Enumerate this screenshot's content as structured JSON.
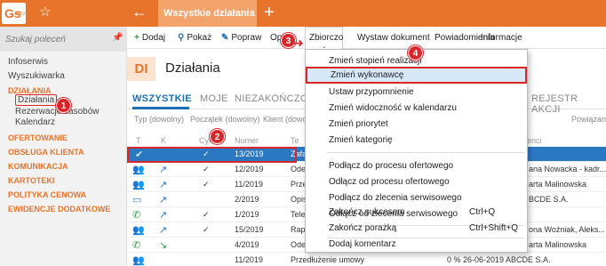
{
  "app": {
    "logo_text": "Gs",
    "logo_sub": "PRO",
    "active_tab": "Wszystkie działania",
    "star_icon": "star-outline-icon",
    "back_icon": "arrow-left-icon",
    "plus_icon": "plus-icon",
    "accent_color": "#e8732a",
    "selection_color": "#2b78c2",
    "highlight_color": "#d9262b"
  },
  "sidebar": {
    "search_placeholder": "Szukaj poleceń",
    "top_links": [
      "Infoserwis",
      "Wyszukiwarka"
    ],
    "sections": {
      "dzialania": "DZIAŁANIA",
      "dzialania_items": [
        "Działania",
        "Rezerwacje zasobów",
        "Kalendarz"
      ],
      "others": [
        "OFERTOWANIE",
        "OBSŁUGA KLIENTA",
        "KOMUNIKACJA",
        "KARTOTEKI",
        "POLITYKA CENOWA",
        "EWIDENCJE DODATKOWE"
      ]
    }
  },
  "toolbar": {
    "dodaj": "Dodaj",
    "pokaz": "Pokaż",
    "popraw": "Popraw",
    "op_partial": "Op",
    "zbiorczo": "Zbiorczo",
    "wystaw": "Wystaw dokument",
    "powiadomienia": "Powiadomienia",
    "informacje": "Informacje"
  },
  "header": {
    "badge": "DI",
    "title": "Działania"
  },
  "tabs": [
    "WSZYSTKIE",
    "MOJE",
    "NIEZAKOŃCZONE",
    "REJESTR AKCJI"
  ],
  "filters": [
    "Typ (dowolny)",
    "Początek (dowolny)",
    "Klient (dowolny)",
    "Powiązani"
  ],
  "columns": {
    "t": "T",
    "k": "K",
    "cyklic": "Cyklic",
    "numer": "Numer",
    "te": "Te",
    "enci": "enci"
  },
  "rows": [
    {
      "numer": "13/2019",
      "col5": "Zafa",
      "check": "✓",
      "right": ""
    },
    {
      "numer": "12/2019",
      "col5": "Odes",
      "check": "✓",
      "right": "ana Nowacka - kadr..."
    },
    {
      "numer": "11/2019",
      "col5": "Prze",
      "check": "✓",
      "right": "arta Malinowska"
    },
    {
      "numer": "2/2019",
      "col5": "Opis",
      "check": "",
      "right": "BCDE S.A."
    },
    {
      "numer": "1/2019",
      "col5": "Tele",
      "check": "✓",
      "right": ""
    },
    {
      "numer": "15/2019",
      "col5": "Rapo",
      "check": "✓",
      "right": "ona Woźniak, Aleks..."
    },
    {
      "numer": "4/2019",
      "col5": "Odes",
      "check": "",
      "right": "arta Malinowska"
    },
    {
      "numer": "11/2019",
      "col5": "Przedłużenie umowy",
      "check": "",
      "right": "0 %  26-06-2019    ABCDE S.A."
    }
  ],
  "menu": {
    "items": [
      {
        "label": "Zmień stopień realizacji",
        "shortcut": ""
      },
      {
        "label": "Zmień wykonawcę",
        "shortcut": ""
      },
      {
        "label": "Ustaw przypomnienie",
        "shortcut": ""
      },
      {
        "label": "Zmień widoczność w kalendarzu",
        "shortcut": ""
      },
      {
        "label": "Zmień priorytet",
        "shortcut": ""
      },
      {
        "label": "Zmień kategorię",
        "shortcut": ""
      },
      {
        "label": "Podłącz do procesu ofertowego",
        "shortcut": ""
      },
      {
        "label": "Odłącz od procesu ofertowego",
        "shortcut": ""
      },
      {
        "label": "Podłącz do zlecenia serwisowego",
        "shortcut": ""
      },
      {
        "label": "Odłącz od zlecenia serwisowego",
        "shortcut": ""
      },
      {
        "label": "Zakończ sukcesem",
        "shortcut": "Ctrl+Q"
      },
      {
        "label": "Zakończ porażką",
        "shortcut": "Ctrl+Shift+Q"
      },
      {
        "label": "Dodaj komentarz",
        "shortcut": ""
      }
    ]
  },
  "callouts": [
    "1",
    "2",
    "3",
    "4"
  ]
}
